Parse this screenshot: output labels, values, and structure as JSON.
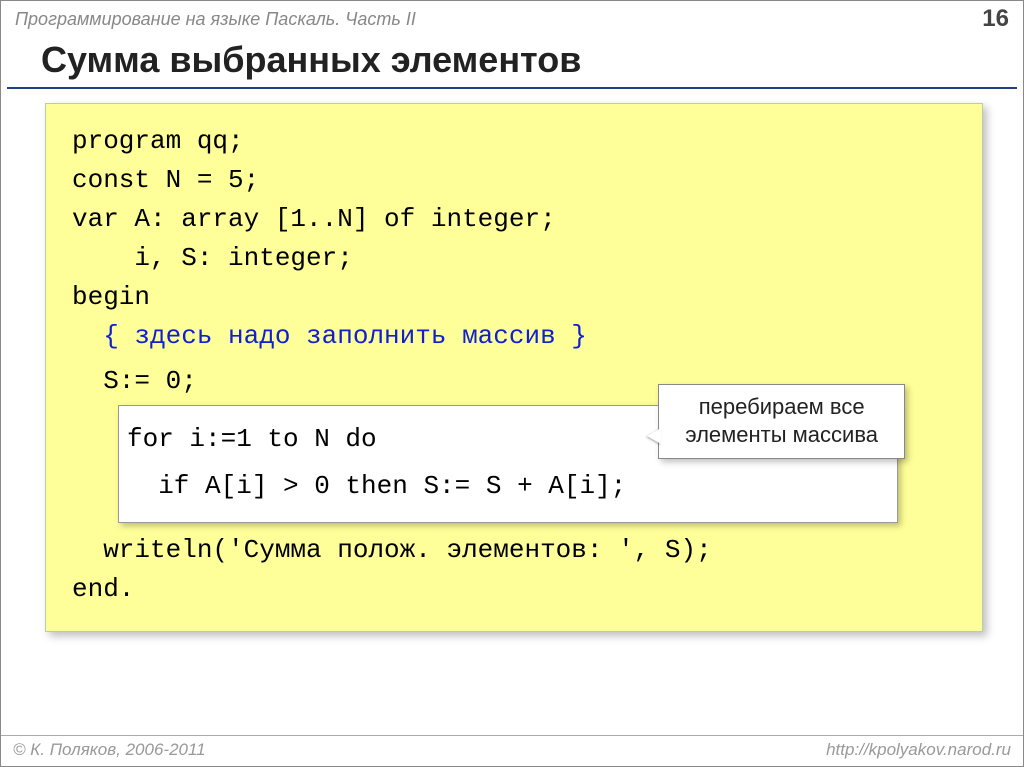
{
  "header": {
    "course_title": "Программирование на языке Паскаль. Часть II",
    "page_number": "16"
  },
  "title": "Сумма выбранных элементов",
  "code": {
    "l1": "program qq;",
    "l2": "const N = 5;",
    "l3": "var A: array [1..N] of integer;",
    "l4": "    i, S: integer;",
    "l5": "begin",
    "l6": "  { здесь надо заполнить массив }",
    "l7": "  S:= 0;",
    "l8_loop1": "for i:=1 to N do",
    "l8_loop2": "  if A[i] > 0 then S:= S + A[i];",
    "l9": "  writeln('Сумма полож. элементов: ', S);",
    "l10": "end."
  },
  "callout": {
    "line1": "перебираем все",
    "line2": "элементы массива"
  },
  "footer": {
    "copyright": "© К. Поляков, 2006-2011",
    "url": "http://kpolyakov.narod.ru"
  }
}
